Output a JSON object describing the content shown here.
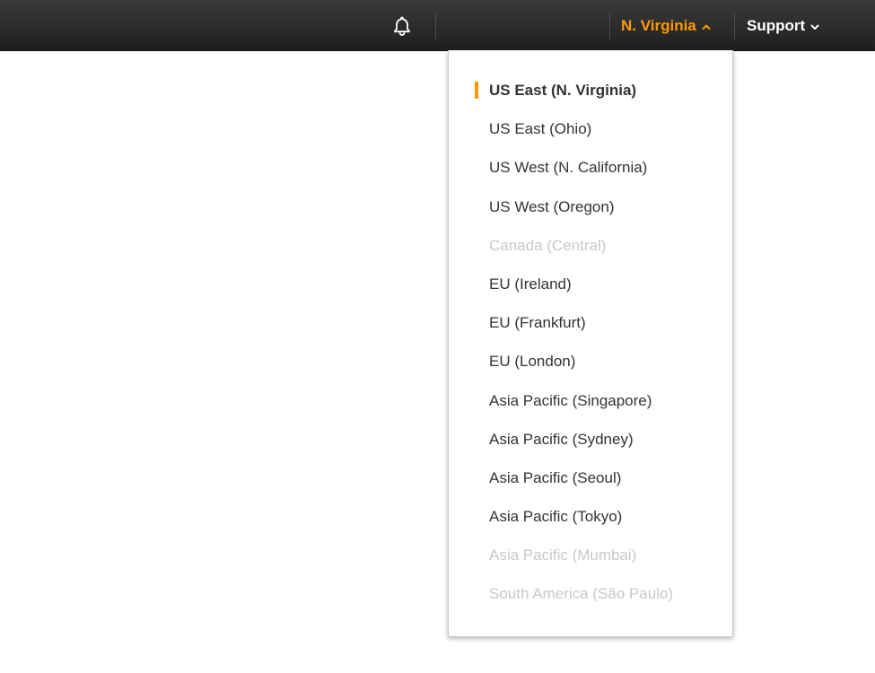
{
  "topbar": {
    "notifications_icon": "bell-icon",
    "region_label": "N. Virginia",
    "region_caret": "caret-up-icon",
    "support_label": "Support",
    "support_caret": "caret-down-icon"
  },
  "colors": {
    "accent": "#ff9900",
    "topbar_bg": "#2b2b2b",
    "text": "#333333",
    "disabled_text": "#c8c8c8"
  },
  "region_menu": {
    "items": [
      {
        "label": "US East (N. Virginia)",
        "state": "selected"
      },
      {
        "label": "US East (Ohio)",
        "state": "enabled"
      },
      {
        "label": "US West (N. California)",
        "state": "enabled"
      },
      {
        "label": "US West (Oregon)",
        "state": "enabled"
      },
      {
        "label": "Canada (Central)",
        "state": "disabled"
      },
      {
        "label": "EU (Ireland)",
        "state": "enabled"
      },
      {
        "label": "EU (Frankfurt)",
        "state": "enabled"
      },
      {
        "label": "EU (London)",
        "state": "enabled"
      },
      {
        "label": "Asia Pacific (Singapore)",
        "state": "enabled"
      },
      {
        "label": "Asia Pacific (Sydney)",
        "state": "enabled"
      },
      {
        "label": "Asia Pacific (Seoul)",
        "state": "enabled"
      },
      {
        "label": "Asia Pacific (Tokyo)",
        "state": "enabled"
      },
      {
        "label": "Asia Pacific (Mumbai)",
        "state": "disabled"
      },
      {
        "label": "South America (São Paulo)",
        "state": "disabled"
      }
    ]
  }
}
